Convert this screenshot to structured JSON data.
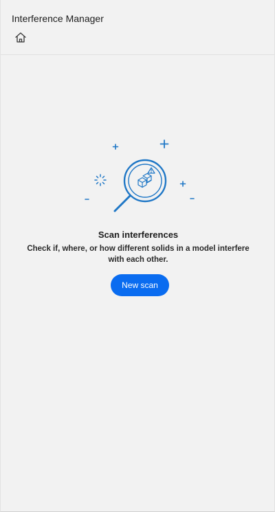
{
  "app": {
    "title": "Interference Manager"
  },
  "header": {
    "home_icon": "home-icon"
  },
  "empty_state": {
    "illustration": "magnifier-scan-icon",
    "title": "Scan interferences",
    "description": "Check if, where, or how different solids in a model interfere with each other.",
    "button_label": "New scan"
  },
  "colors": {
    "accent": "#0a6cf0",
    "illustration_stroke": "#1f77c6",
    "background": "#f2f2f2"
  }
}
